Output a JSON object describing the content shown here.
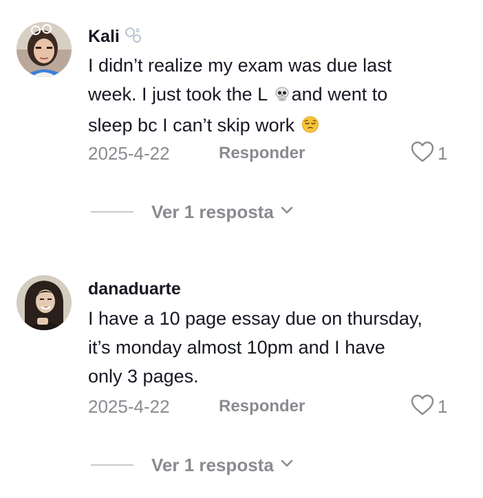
{
  "comments": [
    {
      "username": "Kali",
      "username_badge_icon": "bubbles-icon",
      "lines": [
        {
          "text": "I didn’t realize my exam was due last"
        },
        {
          "before": "week. I just took the L ",
          "emoji": "skull-emoji",
          "after": "and went to"
        },
        {
          "before": "sleep bc I can’t skip work ",
          "emoji": "pensive-face-emoji",
          "after": ""
        }
      ],
      "date": "2025-4-22",
      "reply_label": "Responder",
      "like_count": "1",
      "view_replies_label": "Ver 1 resposta"
    },
    {
      "username": "danaduarte",
      "lines": [
        {
          "text": "I have a 10 page essay due on thursday,"
        },
        {
          "text": "it’s monday almost 10pm and I have"
        },
        {
          "text": "only 3 pages."
        }
      ],
      "date": "2025-4-22",
      "reply_label": "Responder",
      "like_count": "1",
      "view_replies_label": "Ver 1 resposta"
    }
  ],
  "colors": {
    "text_primary": "#161823",
    "text_secondary": "#8a8b91",
    "divider": "#c7c8cc"
  }
}
